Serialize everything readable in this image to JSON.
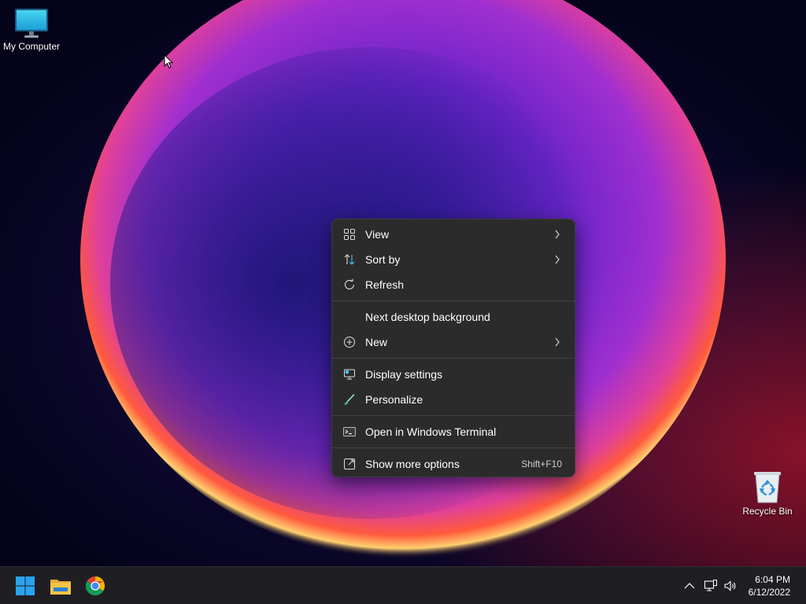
{
  "desktop": {
    "icons": [
      {
        "label": "My Computer",
        "icon": "monitor-icon"
      },
      {
        "label": "Recycle Bin",
        "icon": "recycle-bin-icon"
      }
    ]
  },
  "context_menu": {
    "items": [
      {
        "label": "View",
        "icon": "view-grid-icon",
        "submenu": true
      },
      {
        "label": "Sort by",
        "icon": "sort-icon",
        "submenu": true
      },
      {
        "label": "Refresh",
        "icon": "refresh-icon"
      },
      {
        "label": "Next desktop background"
      },
      {
        "label": "New",
        "icon": "new-plus-icon",
        "submenu": true
      },
      {
        "label": "Display settings",
        "icon": "display-settings-icon"
      },
      {
        "label": "Personalize",
        "icon": "personalize-brush-icon"
      },
      {
        "label": "Open in Windows Terminal",
        "icon": "terminal-icon"
      },
      {
        "label": "Show more options",
        "icon": "show-more-icon",
        "shortcut": "Shift+F10"
      }
    ]
  },
  "taskbar": {
    "apps": [
      "start-windows-icon",
      "file-explorer-icon",
      "chrome-icon"
    ],
    "tray": [
      "show-hidden-icons-chevron-icon",
      "network-icon",
      "volume-icon"
    ],
    "time": "6:04 PM",
    "date": "6/12/2022"
  },
  "colors": {
    "menu_bg": "#2b2b2b",
    "taskbar_bg": "#1f1f23",
    "accent": "#0078d4"
  }
}
